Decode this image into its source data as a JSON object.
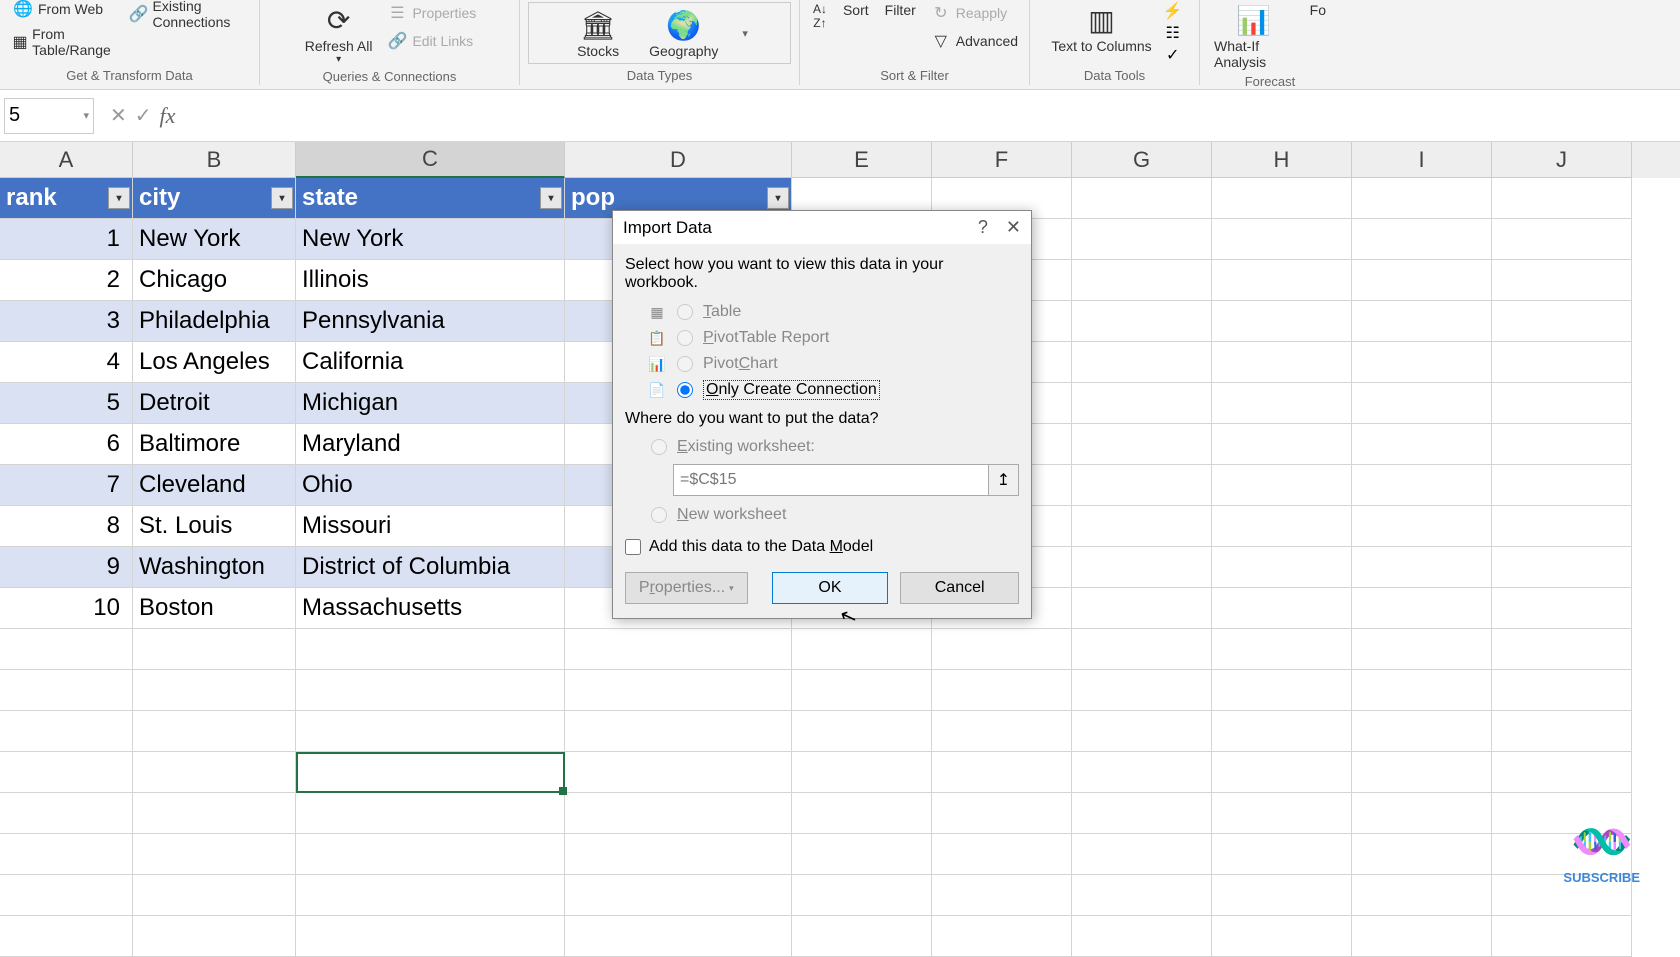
{
  "ribbon": {
    "get_transform": {
      "from_web": "From Web",
      "from_table": "From Table/Range",
      "existing_conn": "Existing Connections",
      "label": "Get & Transform Data"
    },
    "queries": {
      "refresh": "Refresh All",
      "properties": "Properties",
      "edit_links": "Edit Links",
      "label": "Queries & Connections"
    },
    "datatypes": {
      "stocks": "Stocks",
      "geography": "Geography",
      "label": "Data Types"
    },
    "sortfilter": {
      "sort": "Sort",
      "filter": "Filter",
      "reapply": "Reapply",
      "advanced": "Advanced",
      "label": "Sort & Filter"
    },
    "datatools": {
      "text_to_cols": "Text to Columns",
      "label": "Data Tools"
    },
    "forecast": {
      "whatif": "What-If Analysis",
      "fo": "Fo",
      "label": "Forecast"
    }
  },
  "formula_bar": {
    "name_box": "5"
  },
  "columns": [
    "A",
    "B",
    "C",
    "D",
    "E",
    "F",
    "G",
    "H",
    "I",
    "J"
  ],
  "table": {
    "headers": [
      "rank",
      "city",
      "state",
      "pop"
    ],
    "rows": [
      {
        "rank": "1",
        "city": "New York",
        "state": "New York"
      },
      {
        "rank": "2",
        "city": "Chicago",
        "state": "Illinois"
      },
      {
        "rank": "3",
        "city": "Philadelphia",
        "state": "Pennsylvania"
      },
      {
        "rank": "4",
        "city": "Los Angeles",
        "state": "California"
      },
      {
        "rank": "5",
        "city": "Detroit",
        "state": "Michigan"
      },
      {
        "rank": "6",
        "city": "Baltimore",
        "state": "Maryland"
      },
      {
        "rank": "7",
        "city": "Cleveland",
        "state": "Ohio"
      },
      {
        "rank": "8",
        "city": "St. Louis",
        "state": "Missouri"
      },
      {
        "rank": "9",
        "city": "Washington",
        "state": "District of Columbia"
      },
      {
        "rank": "10",
        "city": "Boston",
        "state": "Massachusetts"
      }
    ]
  },
  "dialog": {
    "title": "Import Data",
    "prompt1": "Select how you want to view this data in your workbook.",
    "opt_table": "Table",
    "opt_pivot": "PivotTable Report",
    "opt_chart": "PivotChart",
    "opt_conn": "Only Create Connection",
    "prompt2": "Where do you want to put the data?",
    "existing_ws": "Existing worksheet:",
    "ref_value": "=$C$15",
    "new_ws": "New worksheet",
    "add_model": "Add this data to the Data Model",
    "properties": "Properties...",
    "ok": "OK",
    "cancel": "Cancel"
  },
  "subscribe": "SUBSCRIBE"
}
